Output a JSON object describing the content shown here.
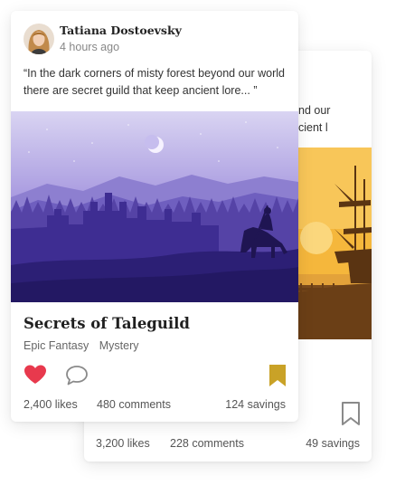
{
  "back_card": {
    "quote_line1": "nd our",
    "quote_line2": "cient l",
    "stats": {
      "likes": "3,200 likes",
      "comments": "228 comments",
      "savings": "49 savings"
    }
  },
  "front_card": {
    "author": "Tatiana Dostoevsky",
    "time": "4 hours ago",
    "quote": "“In the dark corners of misty forest beyond our world there are secret guild that keep ancient lore... ”",
    "title": "Secrets of Taleguild",
    "genres": [
      "Epic Fantasy",
      "Mystery"
    ],
    "stats": {
      "likes": "2,400 likes",
      "comments": "480 comments",
      "savings": "124 savings"
    }
  },
  "colors": {
    "like": "#e8394d",
    "bookmark": "#c9a227",
    "night_sky": "#5a4fa8",
    "sunset": "#f5b73c"
  },
  "icons": {
    "like": "heart-icon",
    "comment": "comment-icon",
    "bookmark": "bookmark-icon"
  }
}
